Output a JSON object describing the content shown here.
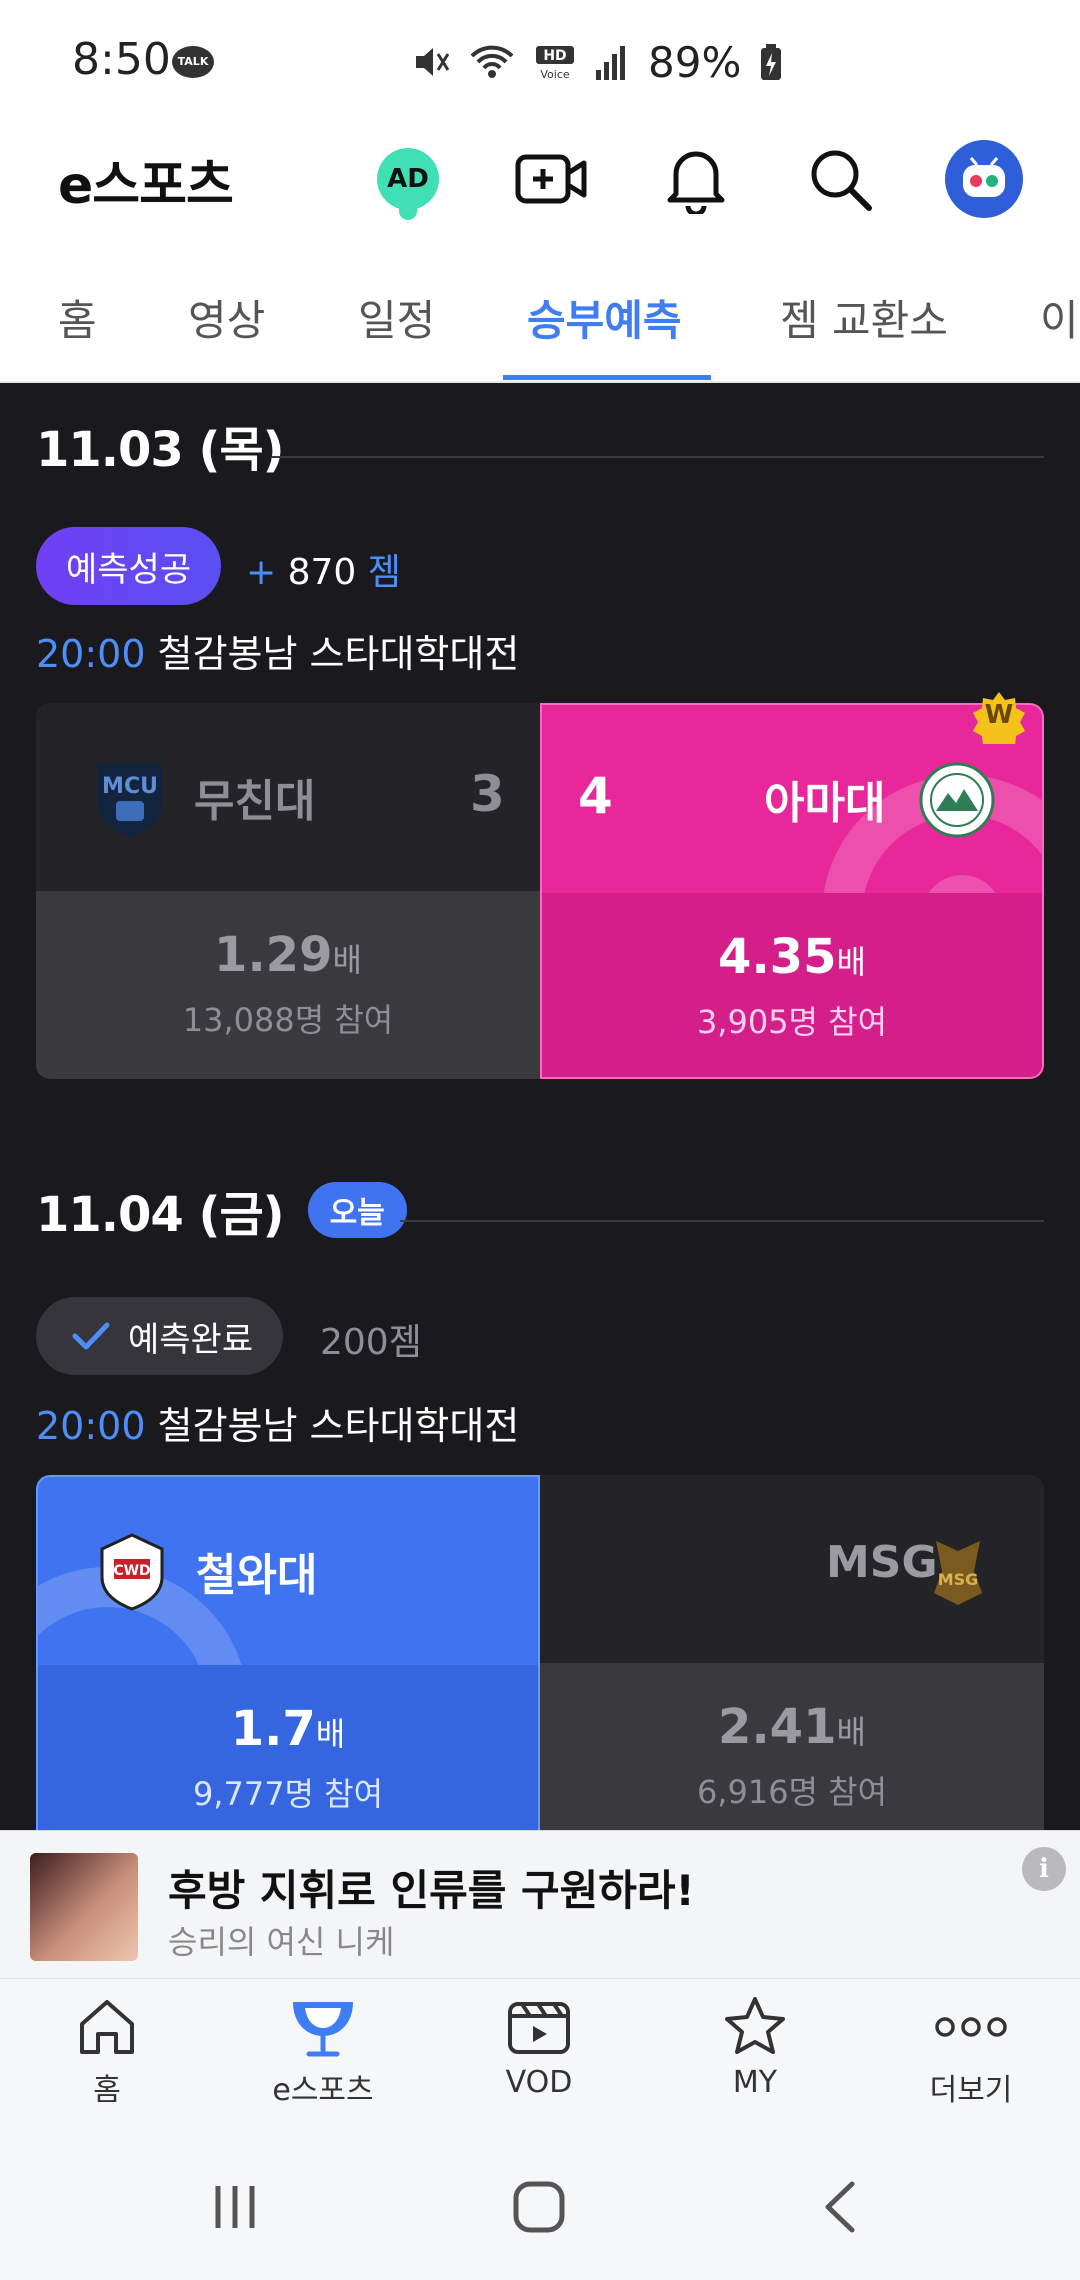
{
  "status_bar": {
    "time": "8:50",
    "talk_badge": "TALK",
    "battery": "89%",
    "hd_voice": "HD Voice"
  },
  "header": {
    "title": "e스포츠",
    "ad_label": "AD",
    "icons": [
      "ad-icon",
      "live-video-icon",
      "bell-icon",
      "search-icon",
      "profile-avatar"
    ]
  },
  "tabs": [
    {
      "label": "홈",
      "active": false
    },
    {
      "label": "영상",
      "active": false
    },
    {
      "label": "일정",
      "active": false
    },
    {
      "label": "승부예측",
      "active": true
    },
    {
      "label": "젬 교환소",
      "active": false
    },
    {
      "label": "이",
      "active": false
    }
  ],
  "days": [
    {
      "date": "11.03 (목)",
      "badge": "",
      "prediction_label": "예측성공",
      "prediction_plus": "+",
      "prediction_value": "870",
      "prediction_unit": "젬",
      "match_time": "20:00",
      "match_title": "철감봉남 스타대학대전",
      "left": {
        "team": "무친대",
        "score": "3",
        "odds": "1.29",
        "odds_unit": "배",
        "participants": "13,088명 참여"
      },
      "right": {
        "team": "아마대",
        "score": "4",
        "odds": "4.35",
        "odds_unit": "배",
        "participants": "3,905명 참여"
      },
      "winner_badge": "W"
    },
    {
      "date": "11.04 (금)",
      "badge": "오늘",
      "prediction_label": "예측완료",
      "prediction_value": "200젬",
      "match_time": "20:00",
      "match_title": "철감봉남 스타대학대전",
      "left": {
        "team": "철와대",
        "odds": "1.7",
        "odds_unit": "배",
        "participants": "9,777명 참여"
      },
      "right": {
        "team": "MSG",
        "odds": "2.41",
        "odds_unit": "배",
        "participants": "6,916명 참여"
      }
    }
  ],
  "ad": {
    "title": "후방 지휘로 인류를 구원하라!",
    "subtitle": "승리의 여신 니케",
    "info": "i"
  },
  "bottom_nav": [
    {
      "label": "홈",
      "icon": "home-icon"
    },
    {
      "label": "e스포츠",
      "icon": "trophy-icon"
    },
    {
      "label": "VOD",
      "icon": "vod-icon"
    },
    {
      "label": "MY",
      "icon": "star-icon"
    },
    {
      "label": "더보기",
      "icon": "more-icon"
    }
  ],
  "colors": {
    "accent": "#3f7df5",
    "pink": "#e8289a",
    "blue": "#3f73f0",
    "dark_bg": "#1a1a1e",
    "card": "#2a2a2f"
  }
}
